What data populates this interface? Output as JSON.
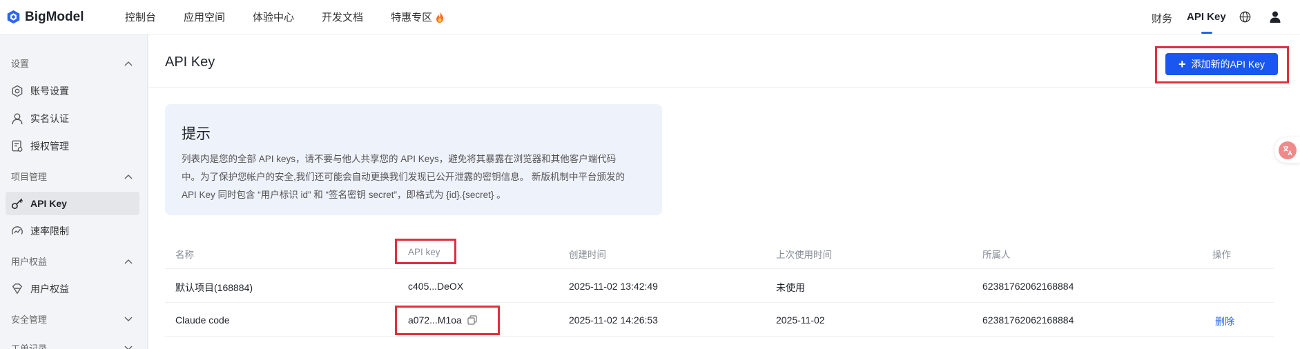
{
  "topbar": {
    "brand": "BigModel",
    "nav": [
      "控制台",
      "应用空间",
      "体验中心",
      "开发文档",
      "特惠专区"
    ],
    "right_finance": "财务",
    "right_apikey": "API Key"
  },
  "sidebar": {
    "groups": [
      {
        "label": "设置",
        "expanded": true
      },
      {
        "label": "项目管理",
        "expanded": true
      },
      {
        "label": "用户权益",
        "expanded": true
      },
      {
        "label": "安全管理",
        "expanded": false
      },
      {
        "label": "工单记录",
        "expanded": false
      }
    ],
    "items": [
      {
        "label": "账号设置",
        "icon": "gear-icon"
      },
      {
        "label": "实名认证",
        "icon": "person-icon"
      },
      {
        "label": "授权管理",
        "icon": "document-icon"
      },
      {
        "label": "API Key",
        "icon": "key-icon",
        "active": true
      },
      {
        "label": "速率限制",
        "icon": "gauge-icon"
      },
      {
        "label": "用户权益",
        "icon": "diamond-icon"
      }
    ]
  },
  "main": {
    "title": "API Key",
    "add_button": "添加新的API Key",
    "tip": {
      "title": "提示",
      "lines": [
        "列表内是您的全部 API keys，请不要与他人共享您的 API Keys，避免将其暴露在浏览器和其他客户端代码",
        "中。为了保护您帐户的安全,我们还可能会自动更换我们发现已公开泄露的密钥信息。 新版机制中平台颁发的",
        "API Key 同时包含 “用户标识 id” 和 “签名密钥 secret”，即格式为 {id}.{secret} 。"
      ]
    },
    "table": {
      "columns": [
        "名称",
        "API key",
        "创建时间",
        "上次使用时间",
        "所属人",
        "操作"
      ],
      "rows": [
        {
          "name": "默认项目(168884)",
          "key": "c405...DeOX",
          "created": "2025-11-02 13:42:49",
          "last_used": "未使用",
          "owner": "62381762062168884",
          "action": ""
        },
        {
          "name": "Claude code",
          "key": "a072...M1oa",
          "created": "2025-11-02 14:26:53",
          "last_used": "2025-11-02",
          "owner": "62381762062168884",
          "action": "删除"
        }
      ]
    }
  },
  "colors": {
    "accent": "#1a57f0",
    "highlight": "#e02f3c",
    "link": "#2563eb"
  }
}
